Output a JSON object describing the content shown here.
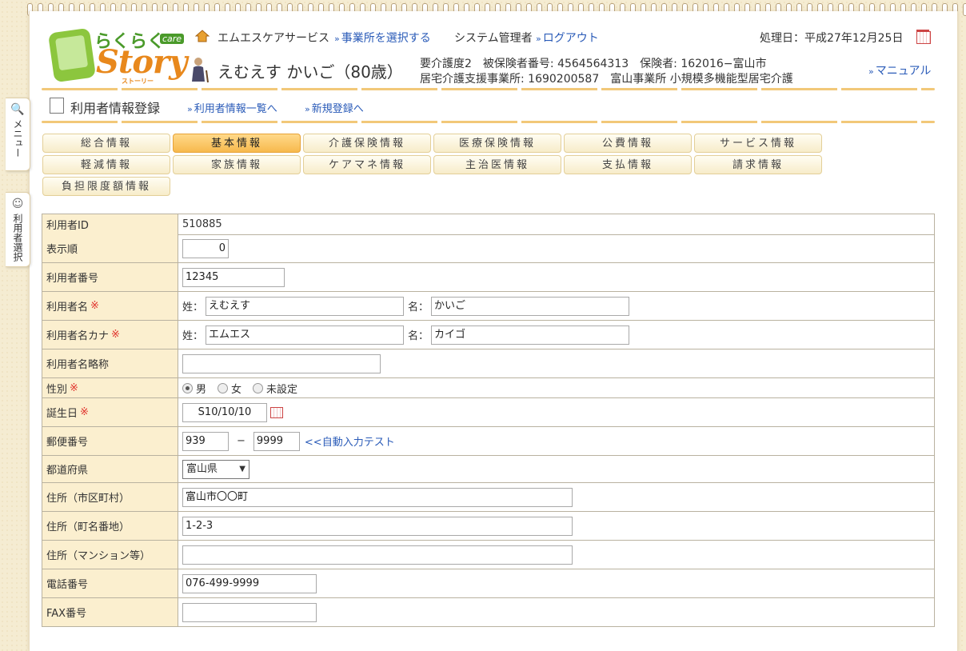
{
  "header": {
    "office": "エムエスケアサービス",
    "select_office": "事業所を選択する",
    "admin": "システム管理者",
    "logout": "ログアウト",
    "process_date": "処理日：平成27年12月25日",
    "manual": "マニュアル",
    "logo_raku": "らくらく",
    "logo_care": "care",
    "logo_story": "Story",
    "logo_kana": "ストーリー"
  },
  "user": {
    "name": "えむえす かいご（80歳）",
    "info_line1": "要介護度2　被保険者番号: 4564564313　保険者: 162016−富山市",
    "info_line2": "居宅介護支援事業所: 1690200587　富山事業所 小規模多機能型居宅介護"
  },
  "side": {
    "menu": "メニュー",
    "user_select": "利用者選択"
  },
  "page": {
    "title": "利用者情報登録",
    "link_list": "利用者情報一覧へ",
    "link_new": "新規登録へ"
  },
  "tabs": [
    "総合情報",
    "基本情報",
    "介護保険情報",
    "医療保険情報",
    "公費情報",
    "サービス情報",
    "軽減情報",
    "家族情報",
    "ケアマネ情報",
    "主治医情報",
    "支払情報",
    "請求情報",
    "負担限度額情報"
  ],
  "form": {
    "user_id_label": "利用者ID",
    "user_id": "510885",
    "order_label": "表示順",
    "order": "0",
    "number_label": "利用者番号",
    "number": "12345",
    "name_label": "利用者名",
    "sei_label": "姓：",
    "sei": "えむえす",
    "mei_label": "名：",
    "mei": "かいご",
    "kana_label": "利用者名カナ",
    "sei_kana": "エムエス",
    "mei_kana": "カイゴ",
    "short_label": "利用者名略称",
    "short": "",
    "gender_label": "性別",
    "gender_male": "男",
    "gender_female": "女",
    "gender_unset": "未設定",
    "birth_label": "誕生日",
    "birth": "S10/10/10",
    "zip_label": "郵便番号",
    "zip1": "939",
    "zip_sep": "−",
    "zip2": "9999",
    "zip_auto": "<<自動入力テスト",
    "pref_label": "都道府県",
    "pref": "富山県",
    "addr1_label": "住所（市区町村）",
    "addr1": "富山市〇〇町",
    "addr2_label": "住所（町名番地）",
    "addr2": "1-2-3",
    "addr3_label": "住所（マンション等）",
    "addr3": "",
    "tel_label": "電話番号",
    "tel": "076-499-9999",
    "fax_label": "FAX番号",
    "fax": "",
    "required_mark": "※"
  }
}
